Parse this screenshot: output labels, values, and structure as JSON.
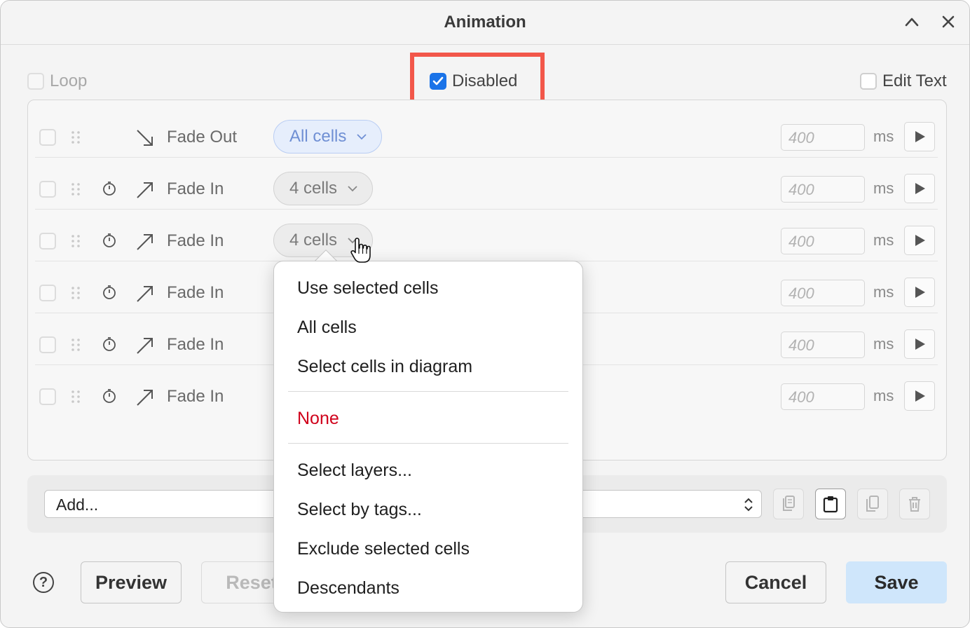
{
  "window": {
    "title": "Animation"
  },
  "options": {
    "loop": {
      "label": "Loop",
      "checked": false,
      "enabled": false
    },
    "disabled": {
      "label": "Disabled",
      "checked": true
    },
    "edit_text": {
      "label": "Edit Text",
      "checked": false
    }
  },
  "steps": [
    {
      "effect": "Fade Out",
      "target": "All cells",
      "duration": "400",
      "unit": "ms",
      "timer": false,
      "arrow": "down-right"
    },
    {
      "effect": "Fade In",
      "target": "4 cells",
      "duration": "400",
      "unit": "ms",
      "timer": true,
      "arrow": "up-right"
    },
    {
      "effect": "Fade In",
      "target": "4 cells",
      "duration": "400",
      "unit": "ms",
      "timer": true,
      "arrow": "up-right"
    },
    {
      "effect": "Fade In",
      "target": "",
      "duration": "400",
      "unit": "ms",
      "timer": true,
      "arrow": "up-right"
    },
    {
      "effect": "Fade In",
      "target": "",
      "duration": "400",
      "unit": "ms",
      "timer": true,
      "arrow": "up-right"
    },
    {
      "effect": "Fade In",
      "target": "",
      "duration": "400",
      "unit": "ms",
      "timer": true,
      "arrow": "up-right"
    }
  ],
  "add_select": {
    "value": "Add..."
  },
  "toolbar_icons": [
    "copy-icon",
    "paste-icon",
    "duplicate-icon",
    "trash-icon"
  ],
  "dropdown_menu": {
    "groups": [
      [
        "Use selected cells",
        "All cells",
        "Select cells in diagram"
      ],
      [
        "None"
      ],
      [
        "Select layers...",
        "Select by tags...",
        "Exclude selected cells",
        "Descendants"
      ]
    ]
  },
  "buttons": {
    "help": "?",
    "preview": "Preview",
    "reset": "Reset",
    "cancel": "Cancel",
    "save": "Save"
  },
  "colors": {
    "accent": "#1a73e8",
    "highlight": "#f2574a",
    "danger": "#d0021b",
    "save_bg": "#cfe6fb"
  }
}
